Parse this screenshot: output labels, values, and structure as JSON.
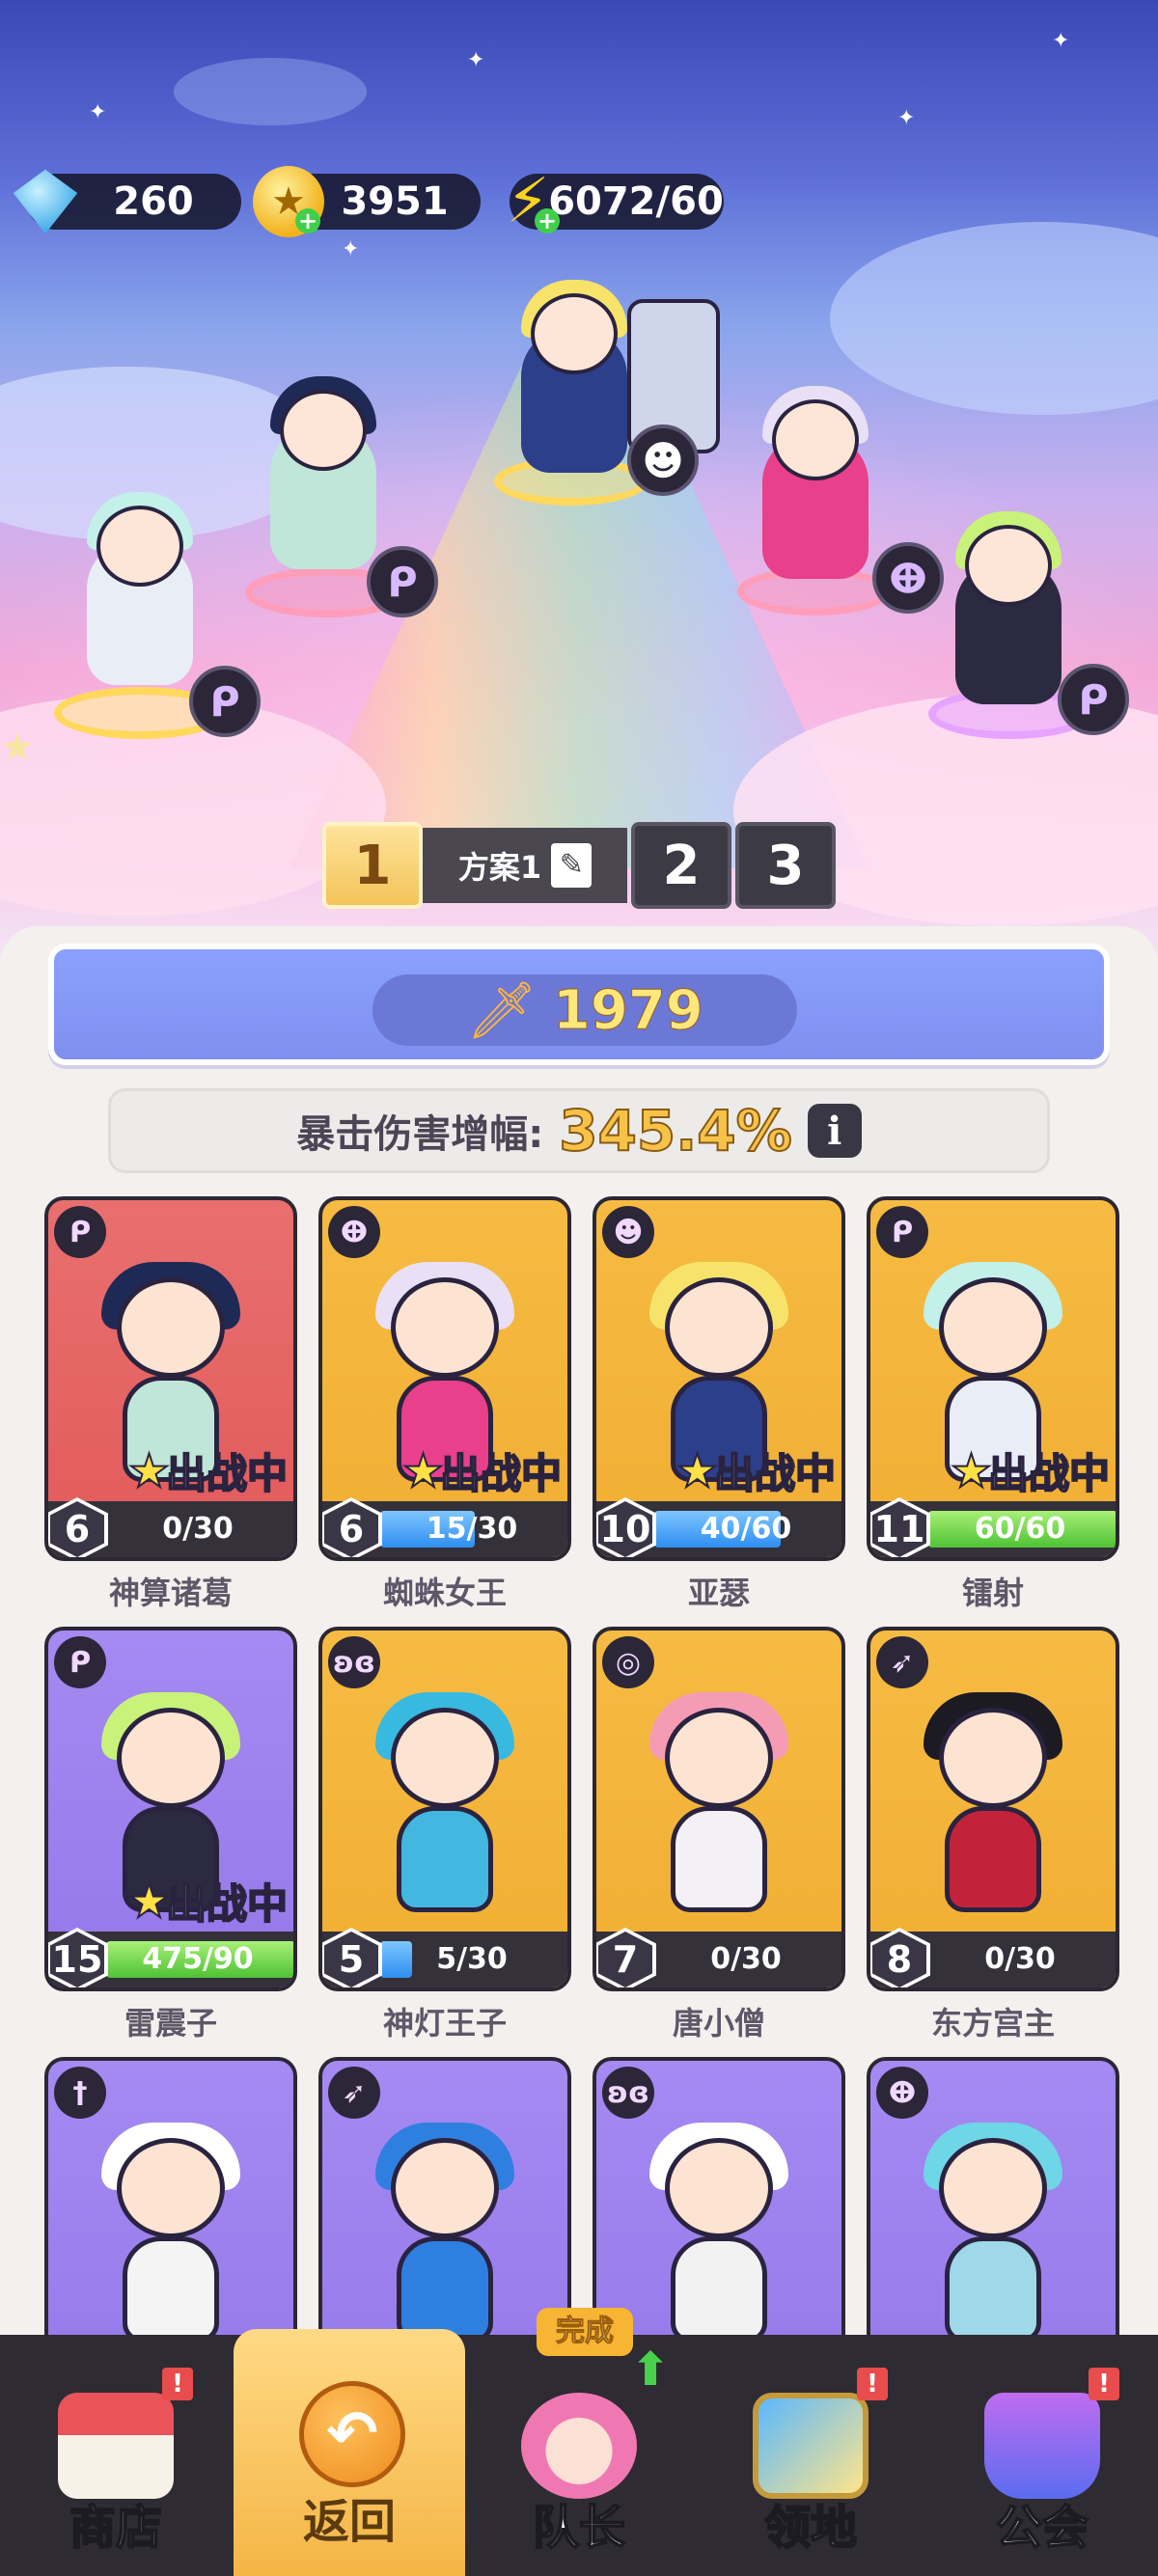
{
  "resources": {
    "gems": "260",
    "gold": "3951",
    "energy": "6072/60"
  },
  "plans": {
    "active": "1",
    "active_name": "方案1",
    "others": [
      "2",
      "3"
    ]
  },
  "power": "1979",
  "crit": {
    "label": "暴击伤害增幅:",
    "value": "345.4%",
    "info": "i"
  },
  "deployed_label": "出战中",
  "heroes": [
    {
      "name": "神算诸葛",
      "level": "6",
      "progress": "0/30",
      "fill": 0,
      "bar": "blue",
      "bg": "red",
      "class_icon": "mage-icon",
      "deployed": true
    },
    {
      "name": "蜘蛛女王",
      "level": "6",
      "progress": "15/30",
      "fill": 0.5,
      "bar": "blue",
      "bg": "gold",
      "class_icon": "potion-icon",
      "deployed": true
    },
    {
      "name": "亚瑟",
      "level": "10",
      "progress": "40/60",
      "fill": 0.667,
      "bar": "blue",
      "bg": "gold",
      "class_icon": "tank-icon",
      "deployed": true
    },
    {
      "name": "镭射",
      "level": "11",
      "progress": "60/60",
      "fill": 1,
      "bar": "green",
      "bg": "gold",
      "class_icon": "mage-icon",
      "deployed": true
    },
    {
      "name": "雷震子",
      "level": "15",
      "progress": "475/90",
      "fill": 1,
      "bar": "green",
      "bg": "purple",
      "class_icon": "mage-icon",
      "deployed": true
    },
    {
      "name": "神灯王子",
      "level": "5",
      "progress": "5/30",
      "fill": 0.167,
      "bar": "blue",
      "bg": "gold",
      "class_icon": "butterfly-icon",
      "deployed": false
    },
    {
      "name": "唐小僧",
      "level": "7",
      "progress": "0/30",
      "fill": 0,
      "bar": "blue",
      "bg": "gold",
      "class_icon": "swirl-icon",
      "deployed": false
    },
    {
      "name": "东方宫主",
      "level": "8",
      "progress": "0/30",
      "fill": 0,
      "bar": "blue",
      "bg": "gold",
      "class_icon": "bow-icon",
      "deployed": false
    },
    {
      "name": "",
      "level": "",
      "progress": "",
      "fill": 0,
      "bar": "blue",
      "bg": "purple",
      "class_icon": "sword-icon",
      "deployed": false
    },
    {
      "name": "",
      "level": "",
      "progress": "",
      "fill": 0,
      "bar": "blue",
      "bg": "purple",
      "class_icon": "bow-icon",
      "deployed": false
    },
    {
      "name": "",
      "level": "",
      "progress": "",
      "fill": 0,
      "bar": "blue",
      "bg": "purple",
      "class_icon": "butterfly-icon",
      "deployed": false
    },
    {
      "name": "",
      "level": "",
      "progress": "",
      "fill": 0,
      "bar": "blue",
      "bg": "purple",
      "class_icon": "potion-icon",
      "deployed": false
    }
  ],
  "nav": {
    "shop": "商店",
    "back": "返回",
    "captain": "队长",
    "territory": "领地",
    "guild": "公会",
    "done": "完成",
    "alert": "!"
  },
  "colors": {
    "accent_gold": "#f6c24a",
    "panel_band": "#8aa0ff",
    "nav_bg": "#2e2b33"
  }
}
